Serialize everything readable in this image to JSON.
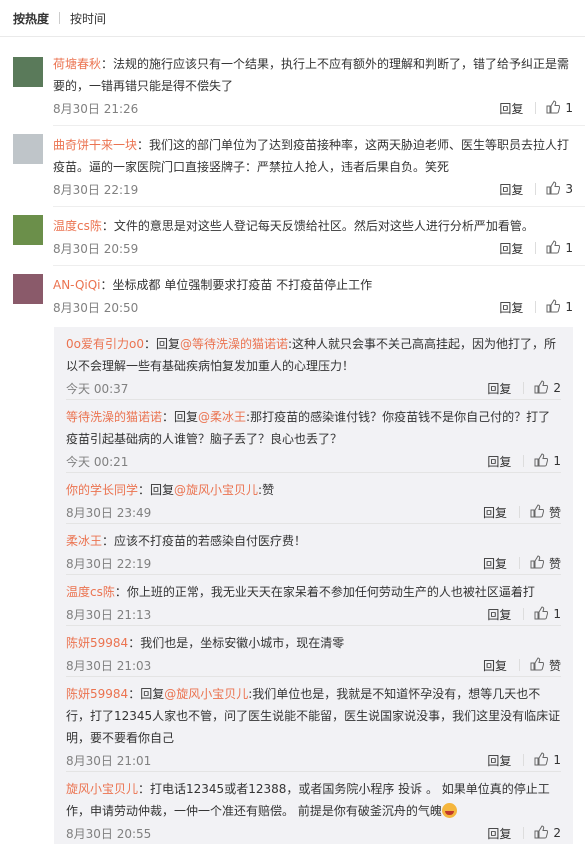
{
  "sort": {
    "hot": "按热度",
    "time": "按时间"
  },
  "labels": {
    "reply": "回复"
  },
  "comments": [
    {
      "user": "荷塘春秋",
      "text": "：法规的施行应该只有一个结果，执行上不应有额外的理解和判断了，错了给予纠正是需要的，一错再错只能是得不偿失了",
      "date": "8月30日 21:26",
      "likes": "1"
    },
    {
      "user": "曲奇饼干来一块",
      "text": "：我们这的部门单位为了达到疫苗接种率，这两天胁迫老师、医生等职员去拉人打疫苗。逼的一家医院门口直接竖牌子：严禁拉人抢人，违者后果自负。笑死",
      "date": "8月30日 22:19",
      "likes": "3"
    },
    {
      "user": "温度cs陈",
      "text": "：文件的意思是对这些人登记每天反馈给社区。然后对这些人进行分析严加看管。",
      "date": "8月30日 20:59",
      "likes": "1"
    },
    {
      "user": "AN-QiQi",
      "text": "：坐标成都 单位强制要求打疫苗 不打疫苗停止工作",
      "date": "8月30日 20:50",
      "likes": "1"
    }
  ],
  "replies": [
    {
      "user": "0o爱有引力o0",
      "text": "：回复",
      "mention": "@等待洗澡的猫诺诺",
      "text2": ":这种人就只会事不关己高高挂起，因为他打了，所以不会理解一些有基础疾病怕复发加重人的心理压力！",
      "date": "今天 00:37",
      "likes": "2"
    },
    {
      "user": "等待洗澡的猫诺诺",
      "text": "：回复",
      "mention": "@柔冰王",
      "text2": ":那打疫苗的感染谁付钱？你疫苗钱不是你自己付的？打了疫苗引起基础病的人谁管？脑子丢了？良心也丢了？",
      "date": "今天 00:21",
      "likes": "1"
    },
    {
      "user": "你的学长同学",
      "text": "：回复",
      "mention": "@旋风小宝贝儿",
      "text2": ":赞",
      "date": "8月30日 23:49",
      "likes": "赞"
    },
    {
      "user": "柔冰王",
      "text": "：应该不打疫苗的若感染自付医疗费！",
      "mention": "",
      "text2": "",
      "date": "8月30日 22:19",
      "likes": "赞"
    },
    {
      "user": "温度cs陈",
      "text": "：你上班的正常，我无业天天在家呆着不参加任何劳动生产的人也被社区逼着打",
      "mention": "",
      "text2": "",
      "date": "8月30日 21:13",
      "likes": "1"
    },
    {
      "user": "陈妍59984",
      "text": "：我们也是，坐标安徽小城市，现在清零",
      "mention": "",
      "text2": "",
      "date": "8月30日 21:03",
      "likes": "赞"
    },
    {
      "user": "陈妍59984",
      "text": "：回复",
      "mention": "@旋风小宝贝儿",
      "text2": ":我们单位也是，我就是不知道怀孕没有，想等几天也不行，打了12345人家也不管，问了医生说能不能留，医生说国家说没事，我们这里没有临床证明，要不要看你自己",
      "date": "8月30日 21:01",
      "likes": "1"
    },
    {
      "user": "旋风小宝贝儿",
      "text": "：打电话12345或者12388，或者国务院小程序 投诉 。 如果单位真的停止工作，申请劳动仲裁，一仲一个准还有赔偿。 前提是你有破釜沉舟的气魄",
      "mention": "",
      "text2": "",
      "date": "8月30日 20:55",
      "likes": "2"
    }
  ]
}
